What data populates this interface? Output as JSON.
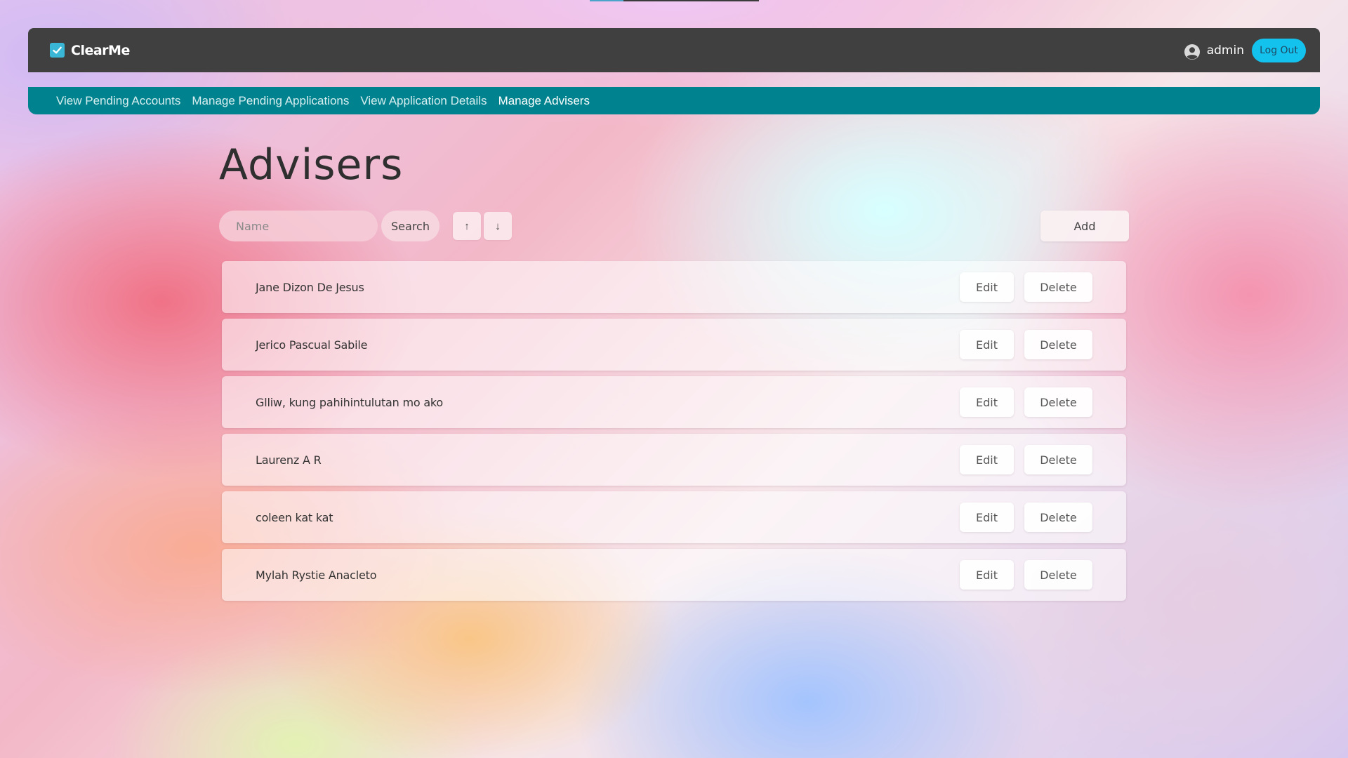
{
  "app": {
    "brand": "ClearMe",
    "user": "admin",
    "logout_label": "Log Out"
  },
  "subnav": {
    "items": [
      "View Pending Accounts",
      "Manage Pending Applications",
      "View Application Details",
      "Manage Advisers"
    ],
    "active": "Manage Advisers"
  },
  "page": {
    "title": "Advisers"
  },
  "toolbar": {
    "search_placeholder": "Name",
    "search_label": "Search",
    "sort_asc_label": "↑",
    "sort_desc_label": "↓",
    "add_label": "Add"
  },
  "advisers": [
    {
      "name": "Jane Dizon De Jesus",
      "edit": "Edit",
      "delete": "Delete"
    },
    {
      "name": "Jerico Pascual Sabile",
      "edit": "Edit",
      "delete": "Delete"
    },
    {
      "name": "Glliw, kung pahihintulutan mo ako",
      "edit": "Edit",
      "delete": "Delete"
    },
    {
      "name": "Laurenz A R",
      "edit": "Edit",
      "delete": "Delete"
    },
    {
      "name": "coleen kat kat",
      "edit": "Edit",
      "delete": "Delete"
    },
    {
      "name": "Mylah Rystie Anacleto",
      "edit": "Edit",
      "delete": "Delete"
    }
  ],
  "colors": {
    "navbar": "#404040",
    "subnav": "#00838f",
    "logout_button": "#14c2ee",
    "brand_check": "#3ab7d6"
  },
  "icons": {
    "brand": "check-square-icon",
    "user": "user-circle-icon"
  }
}
